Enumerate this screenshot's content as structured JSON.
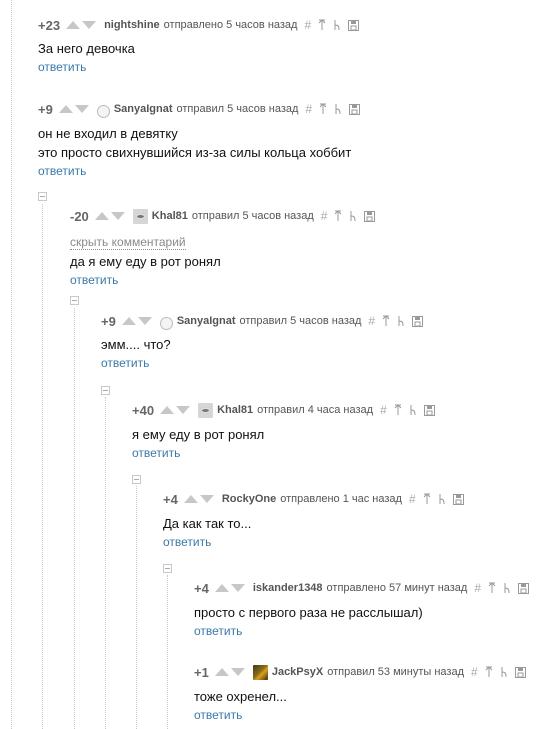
{
  "comments": [
    {
      "rating": "+23",
      "user": "nightshine",
      "meta": "отправлено 5 часов назад",
      "lines": [
        "За него девочка"
      ],
      "reply": "ответить"
    },
    {
      "rating": "+9",
      "user": "SanyaIgnat",
      "meta": "отправил 5 часов назад",
      "lines": [
        "он не входил в девятку",
        "это просто свихнувшийся из-за силы кольца хоббит"
      ],
      "reply": "ответить"
    },
    {
      "rating": "-20",
      "user": "Khal81",
      "meta": "отправил 5 часов назад",
      "hide": "скрыть комментарий",
      "lines": [
        "да я ему еду в рот ронял"
      ],
      "reply": "ответить"
    },
    {
      "rating": "+9",
      "user": "SanyaIgnat",
      "meta": "отправил 5 часов назад",
      "lines": [
        "эмм.... что?"
      ],
      "reply": "ответить"
    },
    {
      "rating": "+40",
      "user": "Khal81",
      "meta": "отправил 4 часа назад",
      "lines": [
        "я ему еду в рот ронял"
      ],
      "reply": "ответить"
    },
    {
      "rating": "+4",
      "user": "RockyOne",
      "meta": "отправлено 1 час назад",
      "lines": [
        "Да как так то..."
      ],
      "reply": "ответить"
    },
    {
      "rating": "+4",
      "user": "iskander1348",
      "meta": "отправлено 57 минут назад",
      "lines": [
        "просто с первого раза не расслышал)"
      ],
      "reply": "ответить"
    },
    {
      "rating": "+1",
      "user": "JackPsyX",
      "meta": "отправил 53 минуты назад",
      "lines": [
        "тоже охренел..."
      ],
      "reply": "ответить"
    }
  ],
  "tool_icons": [
    "hash-icon",
    "arrow-up-icon",
    "branch-icon",
    "save-icon"
  ],
  "colors": {
    "link": "#3a78a8",
    "vote": "#c7c7c7",
    "thread": "#c8c8c8"
  }
}
